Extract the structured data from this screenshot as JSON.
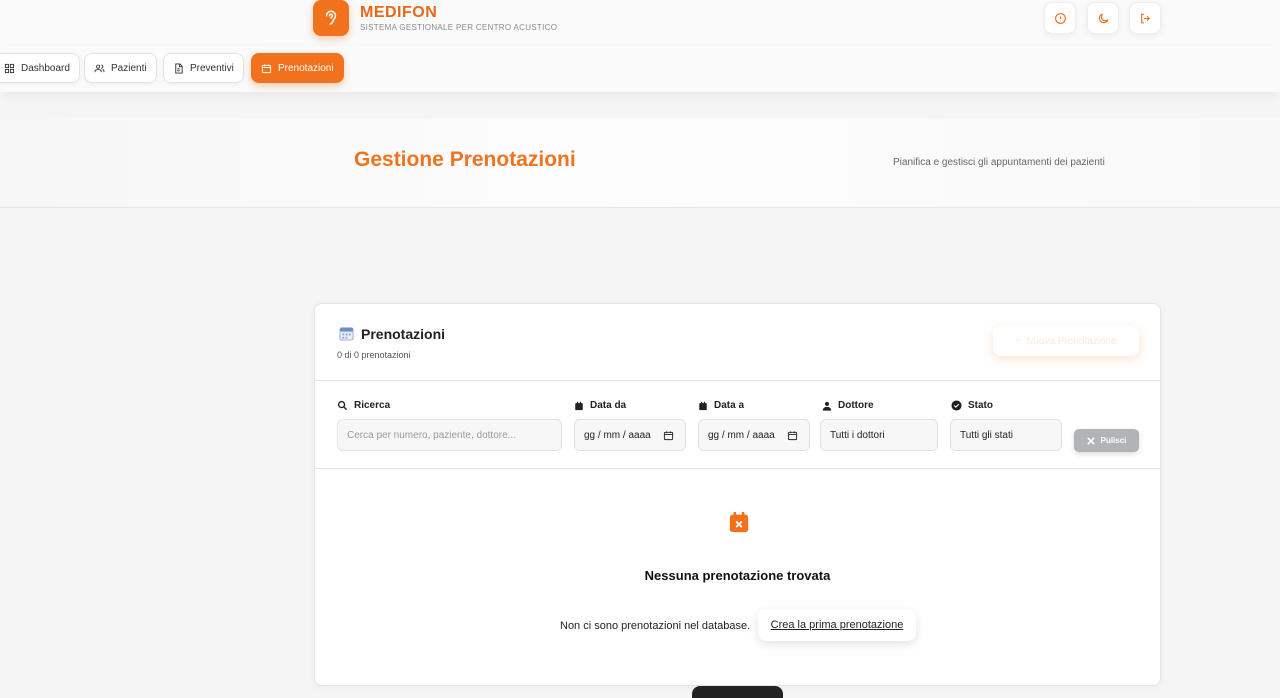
{
  "brand": {
    "name": "MEDIFON",
    "subtitle": "SISTEMA GESTIONALE PER CENTRO ACUSTICO"
  },
  "header_icons": [
    "info-icon",
    "moon-icon",
    "logout-icon"
  ],
  "nav": {
    "items": [
      {
        "label": "Dashboard",
        "icon": "grid-icon"
      },
      {
        "label": "Pazienti",
        "icon": "users-icon"
      },
      {
        "label": "Preventivi",
        "icon": "document-icon"
      },
      {
        "label": "Prenotazioni",
        "icon": "calendar-icon",
        "active": true
      }
    ]
  },
  "hero": {
    "title": "Gestione Prenotazioni",
    "subtitle": "Pianifica e gestisci gli appuntamenti dei pazienti"
  },
  "card": {
    "title": "Prenotazioni",
    "count": "0 di 0 prenotazioni",
    "new_button": "Nuova Prenotazione"
  },
  "filters": {
    "search": {
      "label": "Ricerca",
      "placeholder": "Cerca per numero, paziente, dottore..."
    },
    "date_from": {
      "label": "Data da",
      "value": "gg / mm / aaaa"
    },
    "date_to": {
      "label": "Data a",
      "value": "gg / mm / aaaa"
    },
    "doctor": {
      "label": "Dottore",
      "value": "Tutti i dottori"
    },
    "status": {
      "label": "Stato",
      "value": "Tutti gli stati"
    },
    "clear": "Pulisci"
  },
  "empty": {
    "title": "Nessuna prenotazione trovata",
    "text": "Non ci sono prenotazioni nel database.",
    "link": "Crea la prima prenotazione"
  },
  "colors": {
    "accent": "#f2711c",
    "title": "#ef7422",
    "clear_button": "#b2b3b7"
  }
}
